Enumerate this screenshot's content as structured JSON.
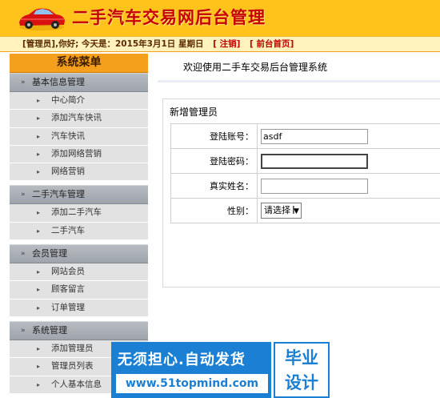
{
  "header": {
    "title": "二手汽车交易网后台管理",
    "user_role": "[管理员]",
    "user_text": ",你好; 今天是：2015年3月1日 星期日",
    "logout_label": "[ 注销]",
    "home_label": "[ 前台首页]"
  },
  "sidebar": {
    "title": "系统菜单",
    "groups": [
      {
        "label": "基本信息管理",
        "items": [
          "中心简介",
          "添加汽车快讯",
          "汽车快讯",
          "添加网络营销",
          "网络营销"
        ]
      },
      {
        "label": "二手汽车管理",
        "items": [
          "添加二手汽车",
          "二手汽车"
        ]
      },
      {
        "label": "会员管理",
        "items": [
          "网站会员",
          "顾客留言",
          "订单管理"
        ]
      },
      {
        "label": "系统管理",
        "items": [
          "添加管理员",
          "管理员列表",
          "个人基本信息"
        ]
      }
    ]
  },
  "main": {
    "welcome": "欢迎使用二手车交易后台管理系统",
    "panel_title": "新增管理员",
    "fields": {
      "account_label": "登陆账号：",
      "account_value": "asdf",
      "password_label": "登陆密码：",
      "password_value": "",
      "realname_label": "真实姓名：",
      "realname_value": "",
      "gender_label": "性别：",
      "gender_selected": "请选择"
    }
  },
  "watermark": {
    "line1": "无须担心.自动发货",
    "line2": "www.51topmind.com",
    "right1": "毕业",
    "right2": "设计"
  },
  "colors": {
    "header_bg": "#ffc31c",
    "title_red": "#c60000",
    "menu_orange": "#f5a01c",
    "group_gray": "#a9afb5",
    "watermark_blue": "#1b7fd4"
  }
}
